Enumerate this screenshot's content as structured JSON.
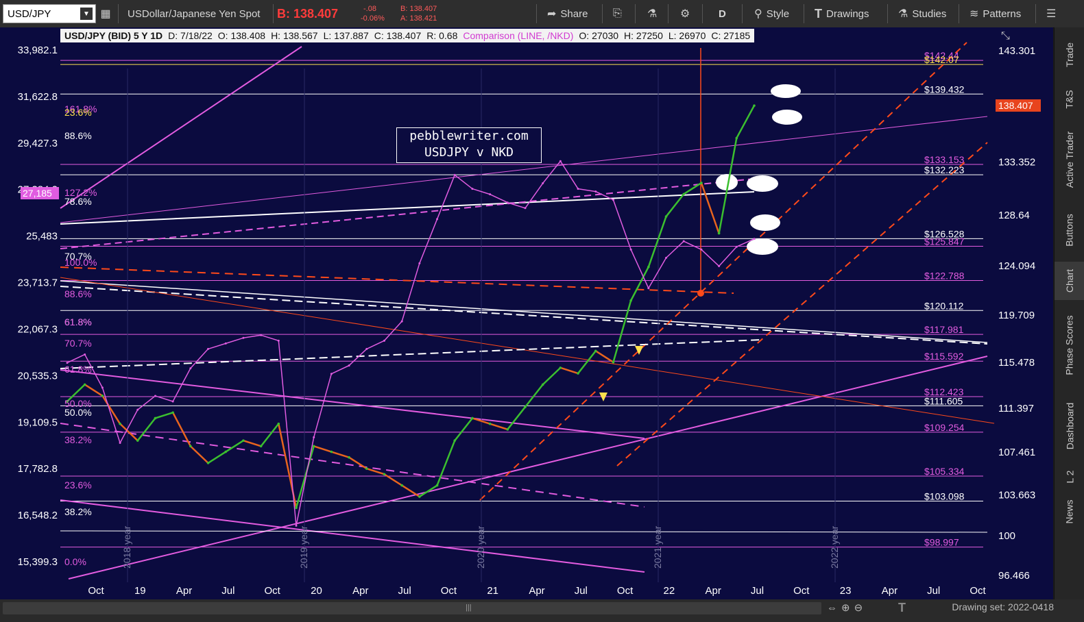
{
  "toolbar": {
    "symbol": "USD/JPY",
    "description": "USDollar/Japanese Yen Spot",
    "bid": "B: 138.407",
    "change": "-.08",
    "change_pct": "-0.06%",
    "bid_small": "B: 138.407",
    "ask_small": "A: 138.421",
    "share": "Share",
    "period": "D",
    "style": "Style",
    "drawings": "Drawings",
    "studies": "Studies",
    "patterns": "Patterns"
  },
  "header": {
    "title": "USD/JPY (BID) 5 Y 1D",
    "date": "D: 7/18/22",
    "open": "O: 138.408",
    "high": "H: 138.567",
    "low": "L: 137.887",
    "close": "C: 138.407",
    "range": "R: 0.68",
    "comparison": "Comparison (LINE, /NKD)",
    "comp_open": "O: 27030",
    "comp_high": "H: 27250",
    "comp_low": "L: 26970",
    "comp_close": "C: 27185"
  },
  "watermark": {
    "line1": "pebblewriter.com",
    "line2": "USDJPY v NKD"
  },
  "sidebar": [
    "Trade",
    "T&S",
    "Active Trader",
    "Buttons",
    "Chart",
    "Phase Scores",
    "Dashboard",
    "L 2",
    "News"
  ],
  "bottom": {
    "drawing_set": "Drawing set: 2022-0418"
  },
  "colors": {
    "background": "#0b0b3f",
    "candles_up": "#3bbf2f",
    "candles_down": "#e8641e",
    "comparison": "#e05ce0",
    "fib_pink": "#e35ce0",
    "fib_white": "#ffffff",
    "fib_orange": "#ff4a1a"
  },
  "chart_data": {
    "type": "line",
    "title": "USD/JPY (BID) 5 Y 1D",
    "x_tick_labels": [
      "Oct",
      "19",
      "Apr",
      "Jul",
      "Oct",
      "20",
      "Apr",
      "Jul",
      "Oct",
      "21",
      "Apr",
      "Jul",
      "Oct",
      "22",
      "Apr",
      "Jul",
      "Oct",
      "23",
      "Apr",
      "Jul",
      "Oct"
    ],
    "year_labels": [
      "2018 year",
      "2019 year",
      "2020 year",
      "2021 year",
      "2022 year"
    ],
    "right_axis": {
      "label": "USD/JPY",
      "ticks": [
        143.301,
        133.352,
        128.64,
        124.094,
        119.709,
        115.478,
        111.397,
        107.461,
        103.663,
        100,
        96.466
      ],
      "ylim": [
        96.466,
        143.301
      ]
    },
    "left_axis": {
      "label": "NKD",
      "ticks": [
        "33,982.1",
        "31,622.8",
        "29,427.3",
        "27,384.2",
        "25,483",
        "23,713.7",
        "22,067.3",
        "20,535.3",
        "19,109.5",
        "17,782.8",
        "16,548.2",
        "15,399.3"
      ]
    },
    "last_price_tag": "138.407",
    "comparison_tag": "27,185",
    "series": [
      {
        "name": "USD/JPY",
        "values": [
          112.0,
          113.5,
          112.5,
          110.0,
          108.5,
          110.5,
          111.0,
          108.0,
          106.5,
          107.5,
          108.5,
          108.0,
          110.0,
          102.5,
          108.0,
          107.5,
          107.0,
          106.0,
          105.5,
          104.5,
          103.5,
          104.5,
          108.5,
          110.5,
          110.0,
          109.5,
          111.5,
          113.5,
          115.0,
          114.5,
          116.5,
          115.5,
          121.0,
          124.0,
          128.5,
          130.5,
          131.5,
          127.0,
          135.5,
          138.4
        ]
      },
      {
        "name": "/NKD",
        "values": [
          22700,
          23000,
          21800,
          19800,
          21000,
          21500,
          21300,
          22500,
          23200,
          23400,
          23600,
          23700,
          23500,
          16800,
          20000,
          22300,
          22600,
          23200,
          23500,
          24200,
          26300,
          27900,
          29500,
          29000,
          28800,
          28500,
          28300,
          29200,
          30000,
          29000,
          28900,
          28600,
          26800,
          25400,
          26500,
          27100,
          26800,
          26200,
          26900,
          27185
        ]
      }
    ],
    "fib_labels_left": [
      {
        "text": "161.8%",
        "color": "pink"
      },
      {
        "text": "23.6%",
        "color": "yellow"
      },
      {
        "text": "88.6%",
        "color": "white"
      },
      {
        "text": "127.2%",
        "color": "pink"
      },
      {
        "text": "78.6%",
        "color": "white"
      },
      {
        "text": "70.7%",
        "color": "white"
      },
      {
        "text": "100.0%",
        "color": "pink"
      },
      {
        "text": "88.6%",
        "color": "pink"
      },
      {
        "text": "61.8%",
        "color": "white"
      },
      {
        "text": "61.8%",
        "color": "pink"
      },
      {
        "text": "70.7%",
        "color": "pink"
      },
      {
        "text": "61.8%",
        "color": "pink"
      },
      {
        "text": "50.0%",
        "color": "pink"
      },
      {
        "text": "50.0%",
        "color": "white"
      },
      {
        "text": "38.2%",
        "color": "pink"
      },
      {
        "text": "23.6%",
        "color": "pink"
      },
      {
        "text": "38.2%",
        "color": "white"
      },
      {
        "text": "0.0%",
        "color": "pink"
      }
    ],
    "price_labels_right": [
      {
        "text": "$142.44",
        "value": 142.44,
        "color": "pink"
      },
      {
        "text": "$142.07",
        "value": 142.07,
        "color": "yellow"
      },
      {
        "text": "$139.432",
        "value": 139.432,
        "color": "white"
      },
      {
        "text": "$133.153",
        "value": 133.153,
        "color": "pink"
      },
      {
        "text": "$132.223",
        "value": 132.223,
        "color": "white"
      },
      {
        "text": "$126.528",
        "value": 126.528,
        "color": "white"
      },
      {
        "text": "$125.847",
        "value": 125.847,
        "color": "pink"
      },
      {
        "text": "$122.788",
        "value": 122.788,
        "color": "pink"
      },
      {
        "text": "$120.112",
        "value": 120.112,
        "color": "white"
      },
      {
        "text": "$117.981",
        "value": 117.981,
        "color": "pink"
      },
      {
        "text": "$115.592",
        "value": 115.592,
        "color": "pink"
      },
      {
        "text": "$112.423",
        "value": 112.423,
        "color": "pink"
      },
      {
        "text": "$111.605",
        "value": 111.605,
        "color": "white"
      },
      {
        "text": "$109.254",
        "value": 109.254,
        "color": "pink"
      },
      {
        "text": "$105.334",
        "value": 105.334,
        "color": "pink"
      },
      {
        "text": "$103.098",
        "value": 103.098,
        "color": "white"
      },
      {
        "text": "$98.997",
        "value": 98.997,
        "color": "pink"
      }
    ]
  }
}
